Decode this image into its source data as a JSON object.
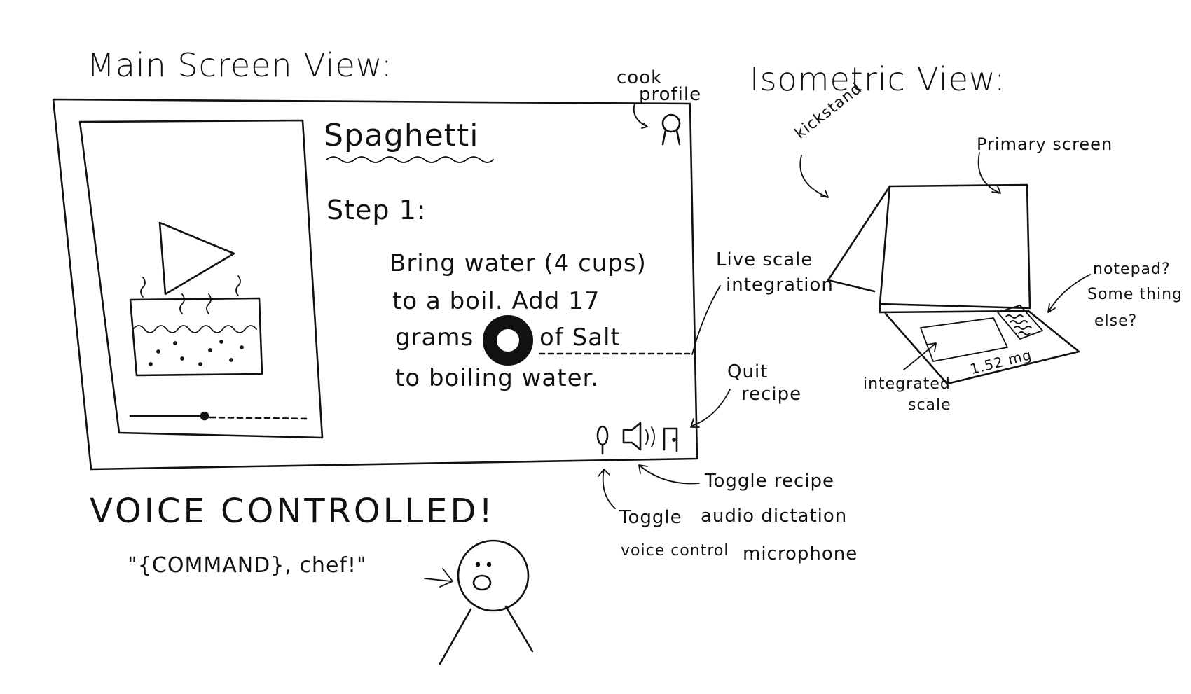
{
  "main_view": {
    "heading": "Main Screen View:",
    "recipe_title": "Spaghetti",
    "step_label": "Step 1:",
    "instruction_lines": [
      "Bring water (4 cups)",
      "to a boil. Add 17",
      "of Salt",
      "to boiling water."
    ],
    "instruction_grams_word": "grams",
    "cook_profile_label": [
      "cook",
      "profile"
    ],
    "live_scale_label": [
      "Live scale",
      "integration"
    ],
    "quit_recipe_label": [
      "Quit",
      "recipe"
    ],
    "toggle_audio_label": [
      "Toggle recipe",
      "audio dictation"
    ],
    "toggle_voice_label": [
      "Toggle",
      "voice control",
      "microphone"
    ],
    "icons": [
      "play-icon",
      "pot-icon",
      "progress-slider",
      "scale-ring-icon",
      "microphone-icon",
      "speaker-icon",
      "door-exit-icon",
      "user-profile-icon"
    ]
  },
  "voice": {
    "heading": "VOICE CONTROLLED!",
    "command": "\"{COMMAND}, chef!\""
  },
  "iso_view": {
    "heading": "Isometric View:",
    "kickstand_label": "kickstand",
    "primary_screen_label": "Primary screen",
    "notepad_label": [
      "notepad?",
      "Some thing",
      "else?"
    ],
    "integrated_scale_label": [
      "integrated",
      "scale"
    ],
    "scale_reading": "1.52 mg"
  }
}
